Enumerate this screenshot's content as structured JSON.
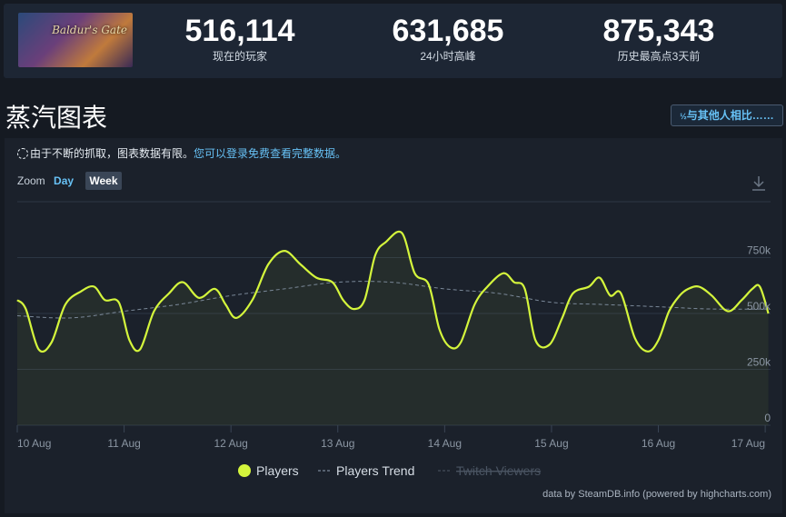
{
  "game": {
    "cover_text": "Baldur's Gate"
  },
  "stats": [
    {
      "value": "516,114",
      "label": "现在的玩家"
    },
    {
      "value": "631,685",
      "label": "24小时高峰"
    },
    {
      "value": "875,343",
      "label": "历史最高点3天前"
    }
  ],
  "page": {
    "title": "蒸汽图表",
    "compare_label": "与其他人相比……",
    "compare_icon": "fraction-icon"
  },
  "notice": {
    "text": "由于不断的抓取，图表数据有限。",
    "link": "您可以登录免费查看完整数据。"
  },
  "zoom": {
    "label": "Zoom",
    "day": "Day",
    "week": "Week"
  },
  "credit": "data by SteamDB.info (powered by highcharts.com)",
  "colors": {
    "players": "#d4f53c",
    "trend": "#7a8898",
    "accent": "#67c1f5"
  },
  "chart_data": {
    "type": "line",
    "x_tick_labels": [
      "10 Aug",
      "11 Aug",
      "12 Aug",
      "13 Aug",
      "14 Aug",
      "15 Aug",
      "16 Aug",
      "17 Aug"
    ],
    "y_tick_labels": [
      "0",
      "250k",
      "500k",
      "750k"
    ],
    "y_ticks": [
      0,
      250000,
      500000,
      750000
    ],
    "ylim": [
      0,
      1000000
    ],
    "xlim": [
      0,
      7.05
    ],
    "grid": true,
    "legend": [
      "Players",
      "Players Trend",
      "Twitch Viewers"
    ],
    "legend_hidden": [
      "Twitch Viewers"
    ],
    "series": [
      {
        "name": "Players",
        "x": [
          0,
          0.08,
          0.2,
          0.32,
          0.45,
          0.6,
          0.72,
          0.82,
          0.95,
          1.05,
          1.15,
          1.28,
          1.42,
          1.55,
          1.7,
          1.85,
          1.95,
          2.05,
          2.2,
          2.35,
          2.5,
          2.65,
          2.8,
          2.95,
          3.05,
          3.15,
          3.25,
          3.35,
          3.45,
          3.6,
          3.72,
          3.85,
          3.95,
          4.05,
          4.15,
          4.28,
          4.4,
          4.55,
          4.65,
          4.75,
          4.85,
          4.98,
          5.1,
          5.2,
          5.35,
          5.45,
          5.55,
          5.65,
          5.78,
          5.9,
          6.0,
          6.1,
          6.2,
          6.28,
          6.38,
          6.5,
          6.65,
          6.78,
          6.88,
          6.95,
          7.03
        ],
        "y": [
          560000,
          520000,
          340000,
          370000,
          540000,
          600000,
          620000,
          560000,
          550000,
          380000,
          340000,
          510000,
          590000,
          640000,
          570000,
          610000,
          540000,
          480000,
          560000,
          720000,
          780000,
          720000,
          660000,
          640000,
          560000,
          520000,
          560000,
          760000,
          820000,
          860000,
          680000,
          630000,
          430000,
          350000,
          370000,
          540000,
          620000,
          680000,
          640000,
          610000,
          380000,
          360000,
          480000,
          590000,
          620000,
          660000,
          580000,
          590000,
          390000,
          330000,
          380000,
          510000,
          580000,
          610000,
          620000,
          580000,
          510000,
          560000,
          610000,
          620000,
          500000
        ]
      },
      {
        "name": "Players Trend",
        "x": [
          0,
          0.5,
          1.0,
          1.5,
          2.0,
          2.5,
          3.0,
          3.5,
          4.0,
          4.5,
          5.0,
          5.5,
          6.0,
          6.5,
          7.03
        ],
        "y": [
          490000,
          480000,
          510000,
          540000,
          580000,
          610000,
          640000,
          640000,
          610000,
          590000,
          550000,
          540000,
          530000,
          520000,
          520000
        ]
      }
    ]
  }
}
